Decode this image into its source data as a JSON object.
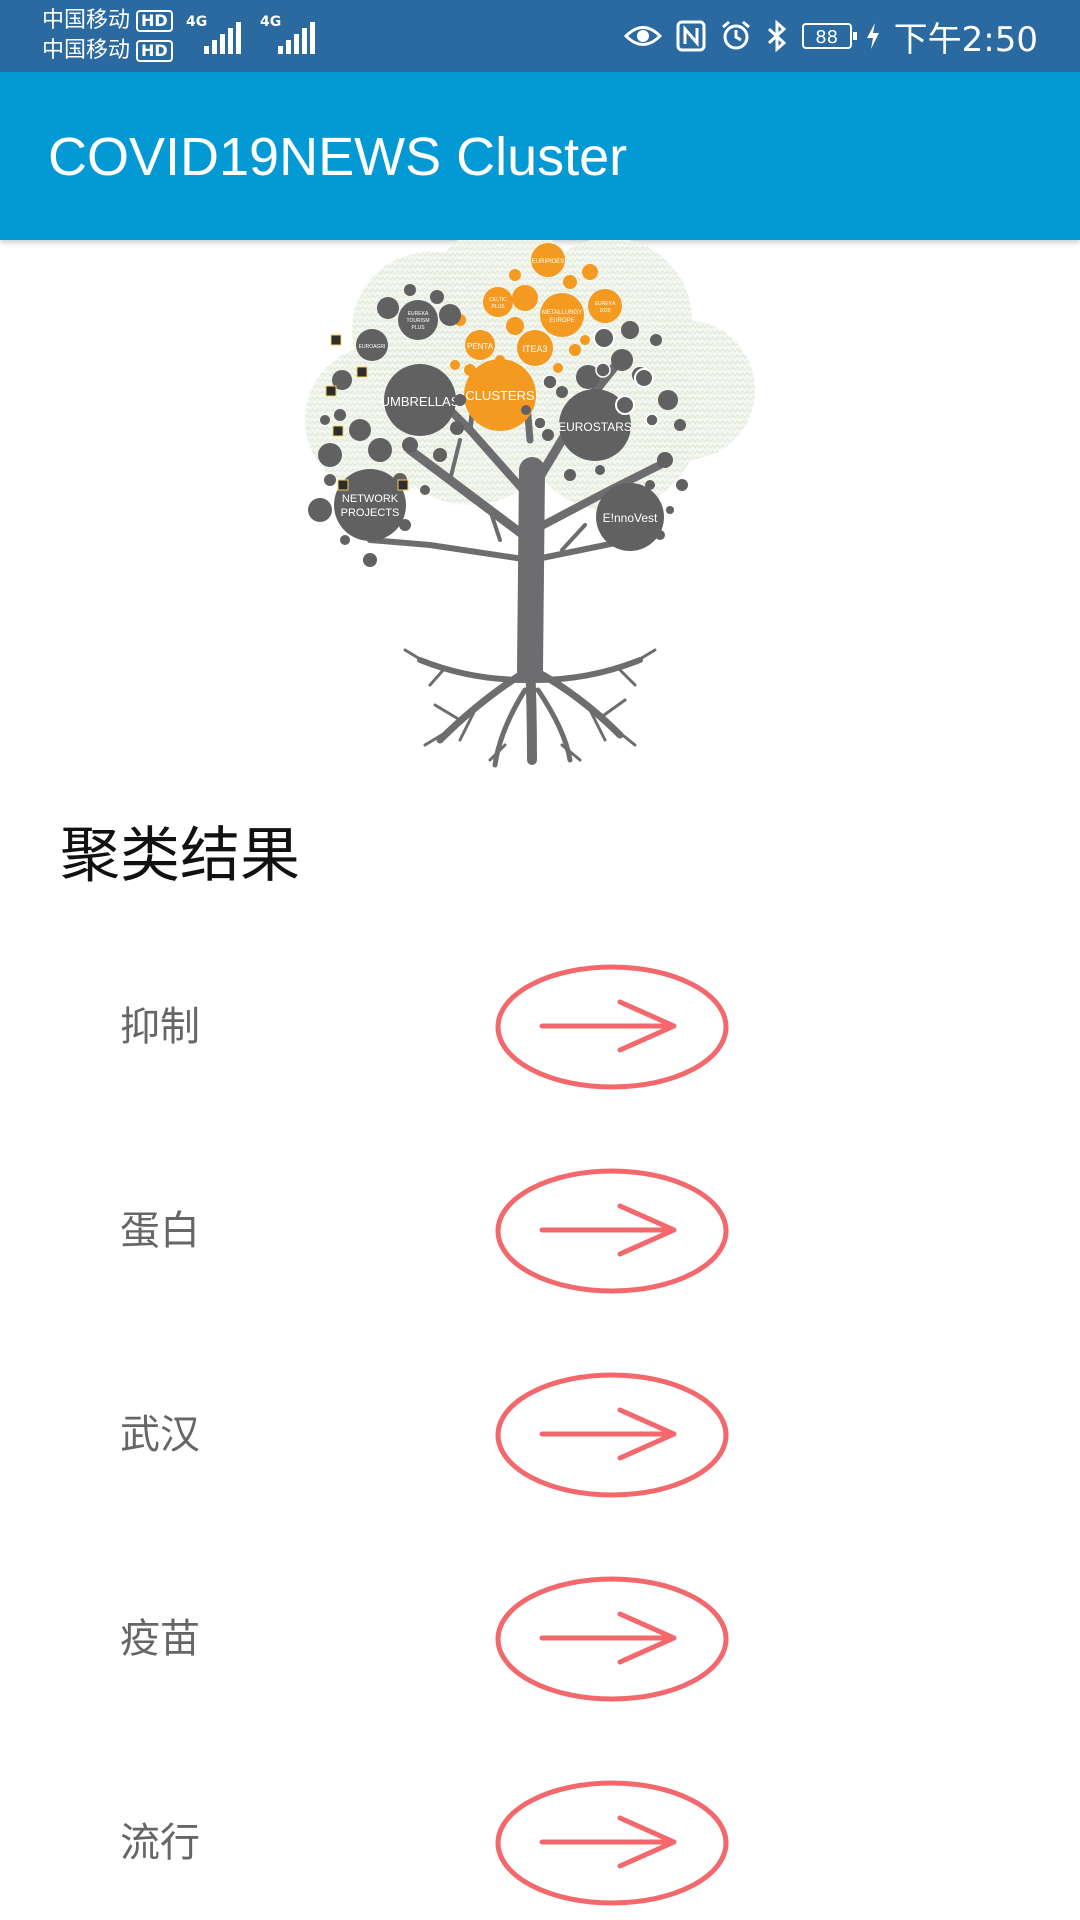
{
  "status_bar": {
    "carrier_1": "中国移动",
    "carrier_2": "中国移动",
    "hd_badge": "HD",
    "network_1": "4G",
    "network_2": "4G",
    "battery": "88",
    "time": "下午2:50"
  },
  "app_bar": {
    "title": "COVID19NEWS Cluster"
  },
  "tree_image": {
    "bubble_labels": {
      "umbrellas": "UMBRELLAS",
      "clusters": "CLUSTERS",
      "eurostars": "EUROSTARS",
      "network_projects_1": "NETWORK",
      "network_projects_2": "PROJECTS",
      "innovest": "E!nnoVest",
      "eureka_1": "EUREKA",
      "eureka_2": "TOURISM",
      "eureka_3": "PLUS",
      "euroagri": "EUROAGRI",
      "penta": "PENTA",
      "itea3": "ITEA3",
      "euripides": "EURIPIDES",
      "celtic": "CELTIC",
      "celtic_2": "PLUS",
      "metallurgy_1": "METALLURGY",
      "metallurgy_2": "EUROPE",
      "eureka_2020_1": "EUREKA",
      "eureka_2020_2": "2020"
    },
    "colors": {
      "gray": "#616161",
      "orange": "#f59a20",
      "pattern": "#e3ebdc",
      "trunk": "#6d6d6f"
    }
  },
  "section_title": "聚类结果",
  "clusters": [
    {
      "label": "抑制"
    },
    {
      "label": "蛋白"
    },
    {
      "label": "武汉"
    },
    {
      "label": "疫苗"
    },
    {
      "label": "流行"
    }
  ],
  "arrow_icon_color": "#f2686c"
}
